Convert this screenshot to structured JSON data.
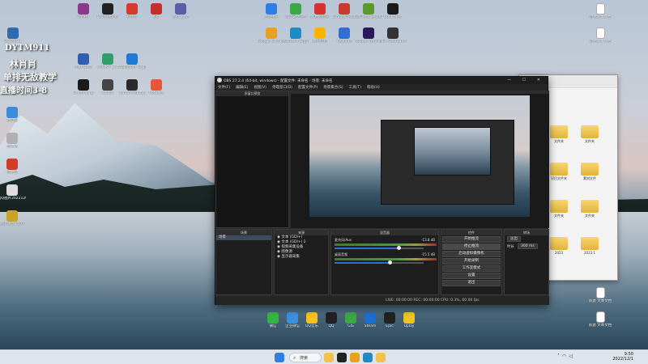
{
  "desktop": {
    "top_icons": [
      {
        "label": "Winrar",
        "color": "#8b3a8b"
      },
      {
        "label": "FoxitReader",
        "color": "#222222"
      },
      {
        "label": "Prism",
        "color": "#d63a2f"
      },
      {
        "label": "64",
        "color": "#c4302b"
      },
      {
        "label": "sync_put",
        "color": "#5b5ea6"
      }
    ],
    "row2_icons": [
      {
        "label": "AlterData",
        "color": "#2f5fb3"
      },
      {
        "label": "ADBKIT 3.4",
        "color": "#2ea06a"
      },
      {
        "label": "Wallpaper Engine",
        "color": "#1f7ad6"
      }
    ],
    "row3_icons": [
      {
        "label": "Grammarly",
        "color": "#1a1a1a"
      },
      {
        "label": "Roblox",
        "color": "#444444"
      },
      {
        "label": "Control Fantasy",
        "color": "#2b2b2b"
      },
      {
        "label": "NetEase",
        "color": "#e8553b"
      }
    ],
    "top_right_icons": [
      {
        "label": "上网手册",
        "color": "#2f7fe0"
      },
      {
        "label": "360安全卫士",
        "color": "#3aa845"
      },
      {
        "label": "网易云音乐",
        "color": "#d7322e"
      },
      {
        "label": "SimplyFocus",
        "color": "#c73c2f"
      },
      {
        "label": "GeForce Experience",
        "color": "#5a9a2a"
      },
      {
        "label": "Controller",
        "color": "#1a1a1a"
      }
    ],
    "second_right_icons": [
      {
        "label": "Google Chrome",
        "color": "#e8a01f"
      },
      {
        "label": "Microsoft Edge",
        "color": "#1f8ac4"
      },
      {
        "label": "腾讯应用",
        "color": "#ffb300"
      },
      {
        "label": "Keynote",
        "color": "#2f6ed2"
      },
      {
        "label": "Adobe Premiere",
        "color": "#2a1a5a"
      },
      {
        "label": "MSI Afterburner",
        "color": "#333333"
      }
    ],
    "left_column_icons": [
      {
        "label": "DYTM911",
        "color": "#2d6cb0"
      },
      {
        "label": "此电脑",
        "color": "#3a8bd8"
      },
      {
        "label": "回收站",
        "color": "#b0b0b0"
      },
      {
        "label": "网易云",
        "color": "#d23a2a"
      },
      {
        "label": "QQ图片2022120...",
        "color": "#dddddd"
      },
      {
        "label": "英雄联盟 2077",
        "color": "#c9a227"
      }
    ],
    "right_column_icons": [
      {
        "label": "新建文本文档",
        "color": "#ffffff"
      },
      {
        "label": "新建文本文档",
        "color": "#ffffff"
      },
      {
        "label": "新建 文本文档",
        "color": "#ffffff"
      },
      {
        "label": "新建 文本文档",
        "color": "#ffffff"
      }
    ],
    "bottom_icons": [
      {
        "label": "微信",
        "color": "#35b542"
      },
      {
        "label": "企业微信",
        "color": "#3b8ee0"
      },
      {
        "label": "QQ音乐",
        "color": "#f4c21a"
      },
      {
        "label": "QQ",
        "color": "#222222"
      },
      {
        "label": "GIS",
        "color": "#3aa845"
      },
      {
        "label": "Steam",
        "color": "#1a6fd0"
      },
      {
        "label": "Epic",
        "color": "#222222"
      },
      {
        "label": "Uplay",
        "color": "#ecc51f"
      }
    ]
  },
  "streamer_text": {
    "line1": "DYTM911",
    "line2": "林肖肖",
    "line3": "单排无敌教学",
    "line4": "直播时间3-8"
  },
  "explorer": {
    "title": "",
    "folders": [
      "文件夹",
      "文件夹",
      "项目文件夹",
      "素材文件",
      "文件夹",
      "文件夹",
      "2023",
      "2023.1"
    ]
  },
  "obs": {
    "title": "OBS 27.2.4 (64-bit, windows) - 配置文件: 未命名 - 场景: 未命名",
    "menu": [
      "文件(F)",
      "编辑(E)",
      "视图(V)",
      "停靠窗口(D)",
      "配置文件(P)",
      "场景集合(S)",
      "工具(T)",
      "帮助(H)"
    ],
    "scene_dock_title": "多窗口预览",
    "docks": {
      "scenes_title": "场景",
      "scenes": [
        "场景"
      ],
      "sources_title": "来源",
      "sources": [
        "文本 (GDI+)",
        "文本 (GDI+) 2",
        "视频采集设备",
        "图像源",
        "显示器采集"
      ],
      "mixer_title": "混音器",
      "channels": [
        {
          "name": "麦克风/Aux",
          "db": "-13.8 dB",
          "level": 0.72
        },
        {
          "name": "桌面音频",
          "db": "-15.5 dB",
          "level": 0.62
        }
      ],
      "transitions_title": "转场",
      "transition_name": "淡出",
      "duration_label": "时长",
      "duration_value": "300 ms",
      "controls_title": "控件",
      "controls": [
        "开始推流",
        "停止推流",
        "启动虚拟摄像机",
        "开始录制",
        "工作室模式",
        "设置",
        "退出"
      ]
    },
    "status": "LIVE: 00:00:00   REC: 00:00:00   CPU: 0.3%, 60.00 fps"
  },
  "taskbar": {
    "search_label": "搜索",
    "time": "9:50",
    "date": "2022/12/1",
    "apps": [
      {
        "name": "windows-start-icon",
        "color": "#2f7fe0"
      },
      {
        "name": "file-explorer-icon",
        "color": "#f2c14e"
      },
      {
        "name": "obs-icon",
        "color": "#222222"
      },
      {
        "name": "chrome-icon",
        "color": "#e8a01f"
      },
      {
        "name": "edge-icon",
        "color": "#1f8ac4"
      },
      {
        "name": "folder-icon",
        "color": "#f2c14e"
      }
    ]
  }
}
